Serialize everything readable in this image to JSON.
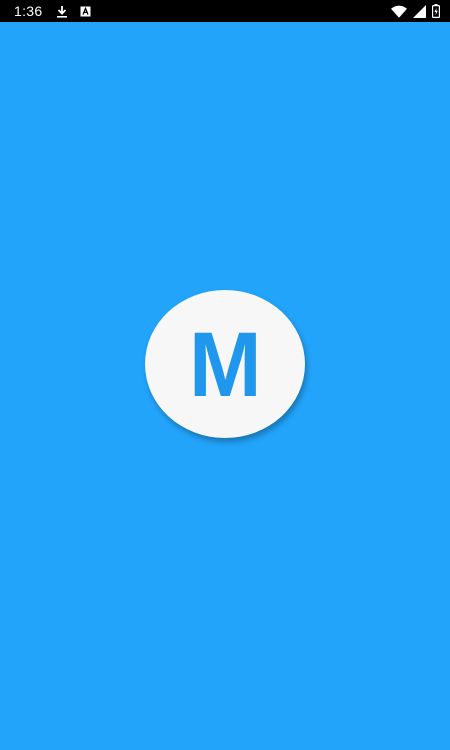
{
  "status_bar": {
    "time": "1:36",
    "icons": [
      "download-icon",
      "a-badge-icon",
      "wifi-icon",
      "signal-icon",
      "battery-icon"
    ],
    "colors": {
      "background": "#000000",
      "foreground": "#ffffff"
    }
  },
  "splash": {
    "logo_letter": "M",
    "colors": {
      "background": "#22a4fb",
      "logo_circle": "#f7f7f7",
      "logo_letter": "#1f97ec"
    }
  }
}
